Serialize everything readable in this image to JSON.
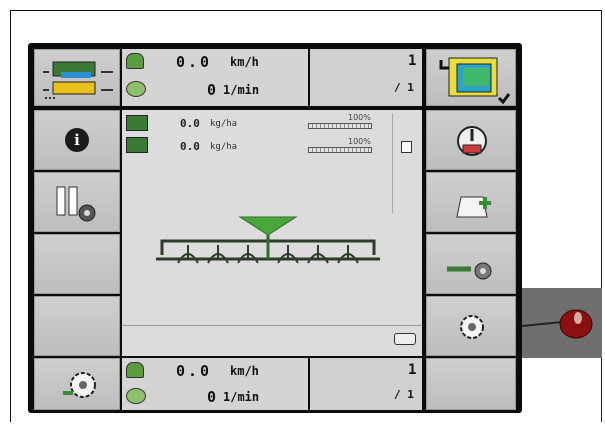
{
  "top_status": {
    "speed_value": "0.0",
    "speed_unit": "km/h",
    "rpm_value": "0",
    "rpm_unit": "1/min",
    "page_current": "1",
    "page_total": "/ 1"
  },
  "application_rates": [
    {
      "value": "0.0",
      "unit": "kg/ha",
      "percent": "100%"
    },
    {
      "value": "0.0",
      "unit": "kg/ha",
      "percent": "100%"
    }
  ],
  "bottom_status": {
    "speed_value": "0.0",
    "speed_unit": "km/h",
    "rpm_value": "0",
    "rpm_unit": "1/min",
    "page_current": "1",
    "page_total": "/ 1"
  },
  "info_glyph": "i",
  "accent_green": "#4aa83a",
  "machine_color": "#2e6e2a",
  "icons": [
    "machine-setup-icon",
    "screen-layout-icon",
    "speed-icon",
    "pto-icon",
    "seed-hopper-icon",
    "info-icon",
    "section-control-icon",
    "power-icon",
    "fill-bag-icon",
    "calibration-icon",
    "settings-gear-icon",
    "settings-menu-icon",
    "seed-drill-icon",
    "gps-icon",
    "remote-sensor-icon"
  ]
}
